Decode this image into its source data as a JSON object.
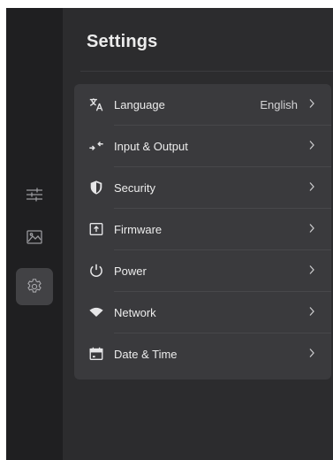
{
  "header": {
    "title": "Settings"
  },
  "rail": [
    {
      "name": "sliders",
      "icon": "sliders-icon",
      "active": false
    },
    {
      "name": "image",
      "icon": "image-icon",
      "active": false
    },
    {
      "name": "settings",
      "icon": "gear-icon",
      "active": true
    }
  ],
  "settings": {
    "items": [
      {
        "label": "Language",
        "value": "English",
        "icon": "translate-icon"
      },
      {
        "label": "Input & Output",
        "value": "",
        "icon": "input-output-icon"
      },
      {
        "label": "Security",
        "value": "",
        "icon": "shield-icon"
      },
      {
        "label": "Firmware",
        "value": "",
        "icon": "firmware-upload-icon"
      },
      {
        "label": "Power",
        "value": "",
        "icon": "power-icon"
      },
      {
        "label": "Network",
        "value": "",
        "icon": "wifi-icon"
      },
      {
        "label": "Date & Time",
        "value": "",
        "icon": "calendar-icon"
      }
    ]
  },
  "colors": {
    "background": "#2c2c2e",
    "rail": "#1f1f21",
    "card": "#3a3a3d",
    "active": "#424245",
    "text": "#ececec"
  }
}
